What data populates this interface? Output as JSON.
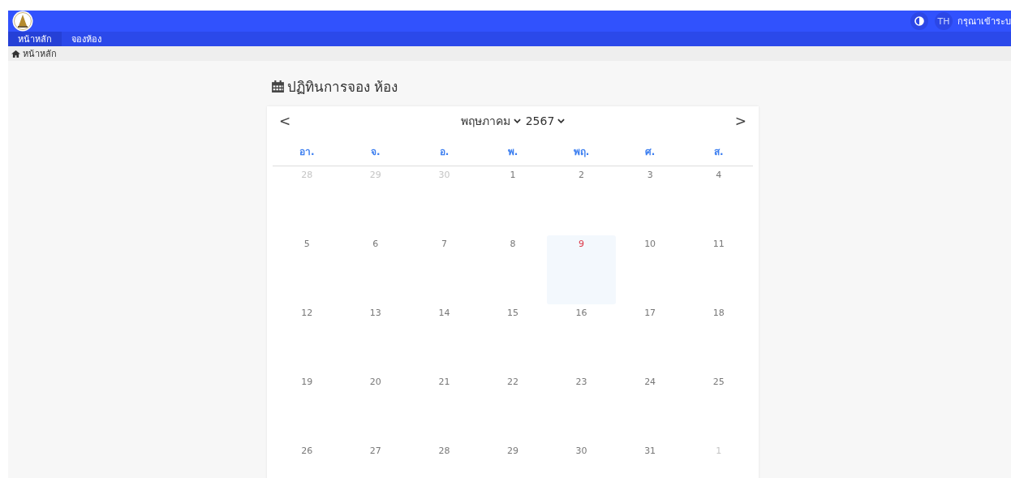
{
  "header": {
    "language": "TH",
    "login_prompt": "กรุณาเข้าระบ"
  },
  "nav": [
    {
      "label": "หน้าหลัก",
      "selected": true
    },
    {
      "label": "จองห้อง",
      "selected": false
    }
  ],
  "breadcrumb": "หน้าหลัก",
  "page_title": "ปฏิทินการจอง ห้อง",
  "calendar": {
    "prev": "<",
    "next": ">",
    "month": "พฤษภาคม",
    "year": "2567",
    "weekdays": [
      "อา.",
      "จ.",
      "อ.",
      "พ.",
      "พฤ.",
      "ศ.",
      "ส."
    ],
    "weeks": [
      [
        {
          "day": "28",
          "other_month": true,
          "today": false
        },
        {
          "day": "29",
          "other_month": true,
          "today": false
        },
        {
          "day": "30",
          "other_month": true,
          "today": false
        },
        {
          "day": "1",
          "other_month": false,
          "today": false
        },
        {
          "day": "2",
          "other_month": false,
          "today": false
        },
        {
          "day": "3",
          "other_month": false,
          "today": false
        },
        {
          "day": "4",
          "other_month": false,
          "today": false
        }
      ],
      [
        {
          "day": "5",
          "other_month": false,
          "today": false
        },
        {
          "day": "6",
          "other_month": false,
          "today": false
        },
        {
          "day": "7",
          "other_month": false,
          "today": false
        },
        {
          "day": "8",
          "other_month": false,
          "today": false
        },
        {
          "day": "9",
          "other_month": false,
          "today": true
        },
        {
          "day": "10",
          "other_month": false,
          "today": false
        },
        {
          "day": "11",
          "other_month": false,
          "today": false
        }
      ],
      [
        {
          "day": "12",
          "other_month": false,
          "today": false
        },
        {
          "day": "13",
          "other_month": false,
          "today": false
        },
        {
          "day": "14",
          "other_month": false,
          "today": false
        },
        {
          "day": "15",
          "other_month": false,
          "today": false
        },
        {
          "day": "16",
          "other_month": false,
          "today": false
        },
        {
          "day": "17",
          "other_month": false,
          "today": false
        },
        {
          "day": "18",
          "other_month": false,
          "today": false
        }
      ],
      [
        {
          "day": "19",
          "other_month": false,
          "today": false
        },
        {
          "day": "20",
          "other_month": false,
          "today": false
        },
        {
          "day": "21",
          "other_month": false,
          "today": false
        },
        {
          "day": "22",
          "other_month": false,
          "today": false
        },
        {
          "day": "23",
          "other_month": false,
          "today": false
        },
        {
          "day": "24",
          "other_month": false,
          "today": false
        },
        {
          "day": "25",
          "other_month": false,
          "today": false
        }
      ],
      [
        {
          "day": "26",
          "other_month": false,
          "today": false
        },
        {
          "day": "27",
          "other_month": false,
          "today": false
        },
        {
          "day": "28",
          "other_month": false,
          "today": false
        },
        {
          "day": "29",
          "other_month": false,
          "today": false
        },
        {
          "day": "30",
          "other_month": false,
          "today": false
        },
        {
          "day": "31",
          "other_month": false,
          "today": false
        },
        {
          "day": "1",
          "other_month": true,
          "today": false
        }
      ]
    ]
  }
}
